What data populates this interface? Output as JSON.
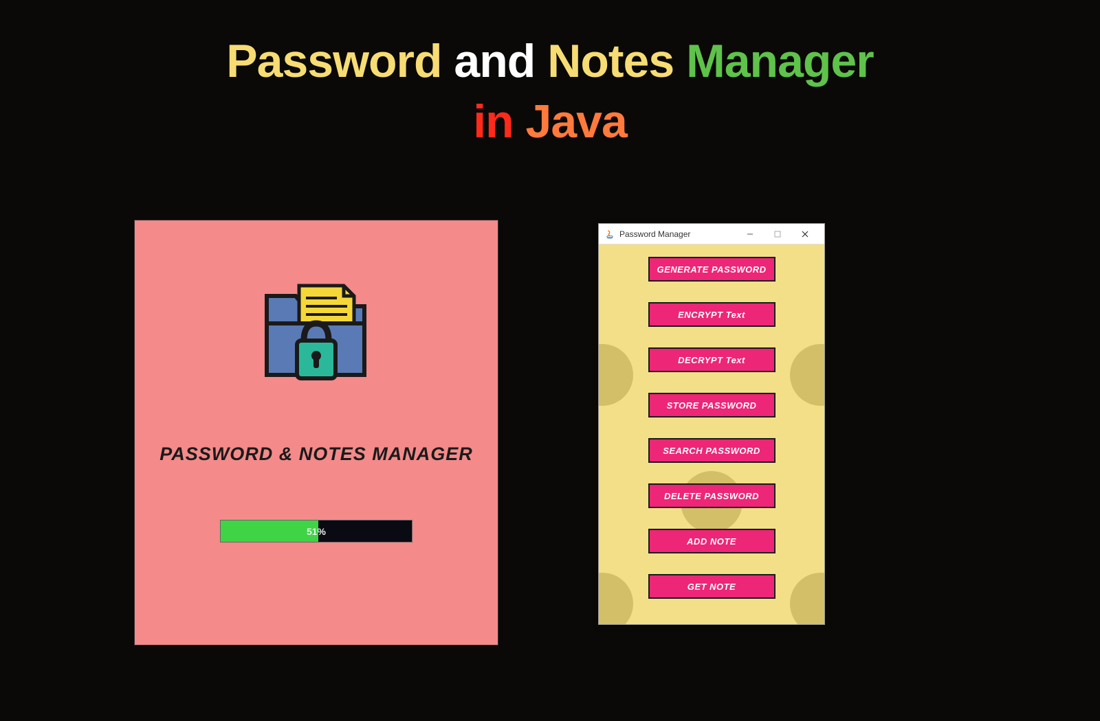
{
  "title": {
    "password": "Password",
    "and": "and",
    "notes": "Notes",
    "manager": "Manager",
    "in": "in",
    "java": "Java"
  },
  "splash": {
    "app_title": "PASSWORD & NOTES MANAGER",
    "progress_percent": 51,
    "progress_label": "51%"
  },
  "menu_window": {
    "title": "Password Manager",
    "buttons": [
      "GENERATE PASSWORD",
      "ENCRYPT Text",
      "DECRYPT Text",
      "STORE PASSWORD",
      "SEARCH PASSWORD",
      "DELETE PASSWORD",
      "ADD NOTE",
      "GET NOTE"
    ]
  },
  "colors": {
    "accent_pink": "#ed2677",
    "salmon": "#f48a8a",
    "yellow_bg": "#f2df88",
    "progress_green": "#3fd445"
  }
}
